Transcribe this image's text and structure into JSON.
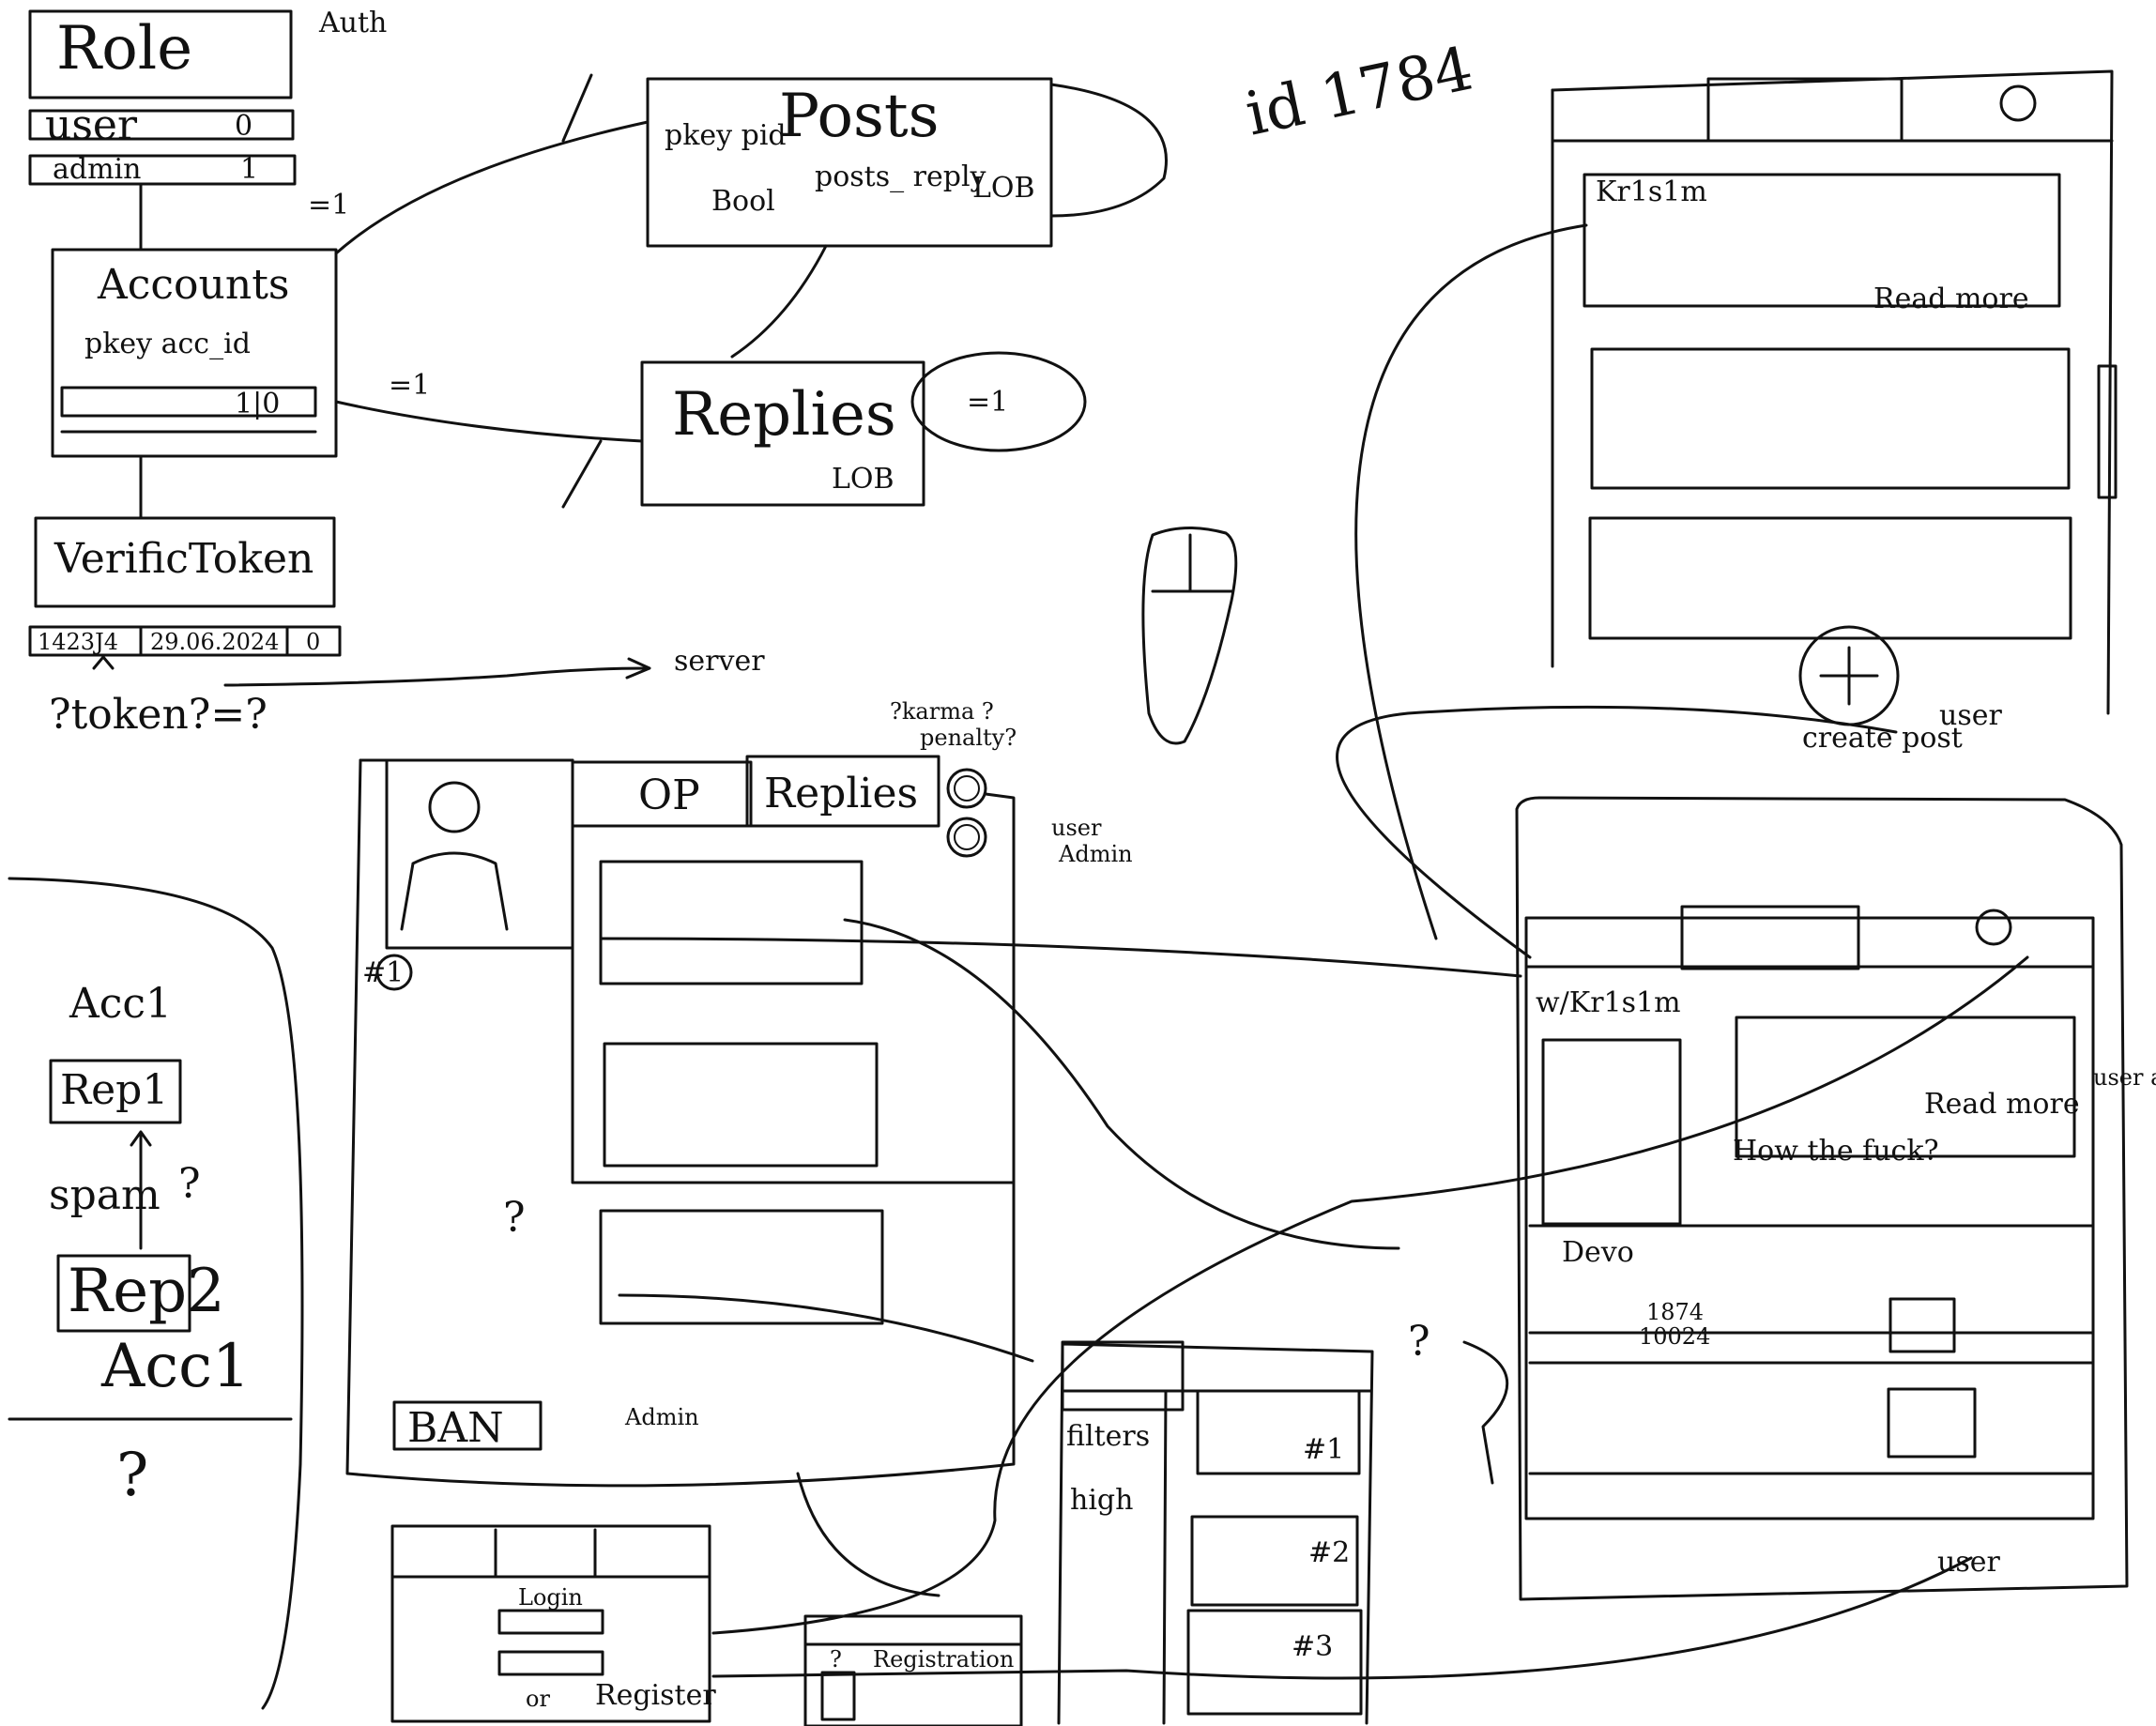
{
  "id_label": "id 1784",
  "db": {
    "role": {
      "title": "Role",
      "auth": "Auth",
      "rows": [
        {
          "name": "user",
          "val": "0"
        },
        {
          "name": "admin",
          "val": "1"
        }
      ]
    },
    "eq1_a": "=1",
    "eq1_b": "=1",
    "eq1_c": "=1",
    "accounts": {
      "title": "Accounts",
      "pk": "pkey acc_id",
      "row_vals": "1|0"
    },
    "verific": {
      "title": "VerificToken",
      "row_token": "1423J4",
      "row_date": "29.06.2024",
      "row_flag": "0"
    },
    "token_note": "?token?=?",
    "server": "server",
    "posts": {
      "title": "Posts",
      "pk": "pkey pid",
      "bool": "Bool",
      "reply": "posts_ reply",
      "lob": "LOB"
    },
    "replies": {
      "title": "Replies",
      "lob": "LOB"
    }
  },
  "post_view": {
    "karma": "?karma ?",
    "penalty": "penalty?",
    "tab_op": "OP",
    "tab_replies": "Replies",
    "user": "user",
    "admin": "Admin",
    "badge": "#1",
    "ban": "BAN",
    "ban_admin": "Admin",
    "question": "?"
  },
  "spam_note": {
    "acc_top": "Acc1",
    "rep1": "Rep1",
    "spam": "spam",
    "q": "?",
    "rep2": "Rep2",
    "acc_bottom": "Acc1",
    "q2": "?"
  },
  "feed": {
    "user": "Kr1s1m",
    "read_more": "Read more",
    "create_post": "create post",
    "user_role": "user"
  },
  "thread": {
    "user": "w/Kr1s1m",
    "read_more": "Read more",
    "comment": "How the fuck?",
    "user2": "Devo",
    "score_a": "1874",
    "score_b": "10024",
    "role_user_admin": "user admin",
    "role_user": "user",
    "side_question": "?"
  },
  "filters": {
    "label": "filters",
    "sort": "high",
    "items": [
      "#1",
      "#2",
      "#3"
    ]
  },
  "login": {
    "title": "Login",
    "or": "or",
    "register": "Register"
  },
  "registration": {
    "title": "Registration",
    "q": "?"
  }
}
